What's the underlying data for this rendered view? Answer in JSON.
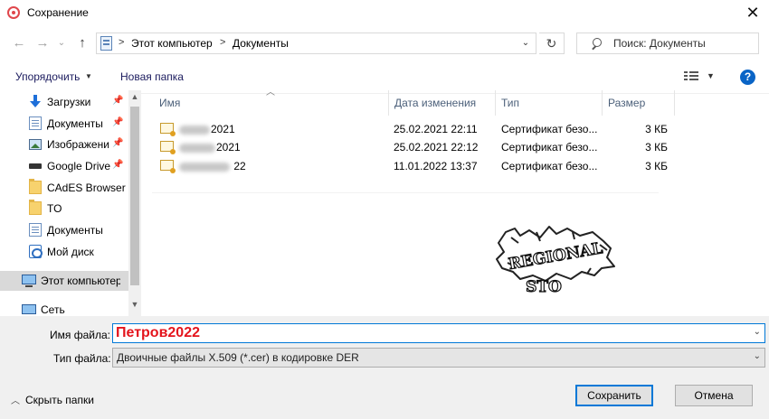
{
  "window": {
    "title": "Сохранение",
    "close_glyph": "✕"
  },
  "navigation": {
    "back_glyph": "←",
    "forward_glyph": "→",
    "recent_glyph": "⌄",
    "up_glyph": "↑",
    "breadcrumb": [
      "Этот компьютер",
      "Документы"
    ],
    "separator": ">",
    "refresh_glyph": "↻",
    "search_placeholder": "Поиск: Документы"
  },
  "toolbar": {
    "organize_label": "Упорядочить",
    "new_folder_label": "Новая папка",
    "help_glyph": "?"
  },
  "sidebar": {
    "items": [
      {
        "label": "Загрузки",
        "icon": "download-arrow-icon",
        "pinned": true
      },
      {
        "label": "Документы",
        "icon": "document-icon",
        "pinned": true
      },
      {
        "label": "Изображени",
        "icon": "pictures-icon",
        "pinned": true
      },
      {
        "label": "Google Drive",
        "icon": "drive-icon",
        "pinned": true
      },
      {
        "label": "CAdES Browser P",
        "icon": "folder-icon",
        "pinned": false
      },
      {
        "label": "TO",
        "icon": "folder-icon",
        "pinned": false
      },
      {
        "label": "Документы",
        "icon": "document-icon",
        "pinned": false
      },
      {
        "label": "Мой диск",
        "icon": "cloud-drive-icon",
        "pinned": false
      },
      {
        "label": "Этот компьютер",
        "icon": "computer-icon",
        "pinned": false,
        "selected": true
      },
      {
        "label": "Сеть",
        "icon": "network-icon",
        "pinned": false
      }
    ]
  },
  "file_list": {
    "columns": [
      "Имя",
      "Дата изменения",
      "Тип",
      "Размер"
    ],
    "rows": [
      {
        "name_visible": "2021",
        "modified": "25.02.2021 22:11",
        "type": "Сертификат безо...",
        "size": "3 КБ"
      },
      {
        "name_visible": "2021",
        "modified": "25.02.2021 22:12",
        "type": "Сертификат безо...",
        "size": "3 КБ"
      },
      {
        "name_visible": " 22",
        "modified": "11.01.2022 13:37",
        "type": "Сертификат безо...",
        "size": "3 КБ"
      }
    ]
  },
  "stamp": {
    "top_text": "REGIONAL",
    "bottom_text": "STO"
  },
  "save_form": {
    "filename_label": "Имя файла:",
    "filename_value": "Петров2022",
    "filetype_label": "Тип файла:",
    "filetype_value": "Двоичные файлы X.509 (*.cer) в кодировке DER",
    "hide_folders_label": "Скрыть папки",
    "save_label": "Сохранить",
    "cancel_label": "Отмена"
  },
  "colors": {
    "accent": "#0078d7",
    "filename_text": "#e4141c",
    "selection_bg": "#d9d9d9",
    "footer_bg": "#f0f0f0"
  }
}
